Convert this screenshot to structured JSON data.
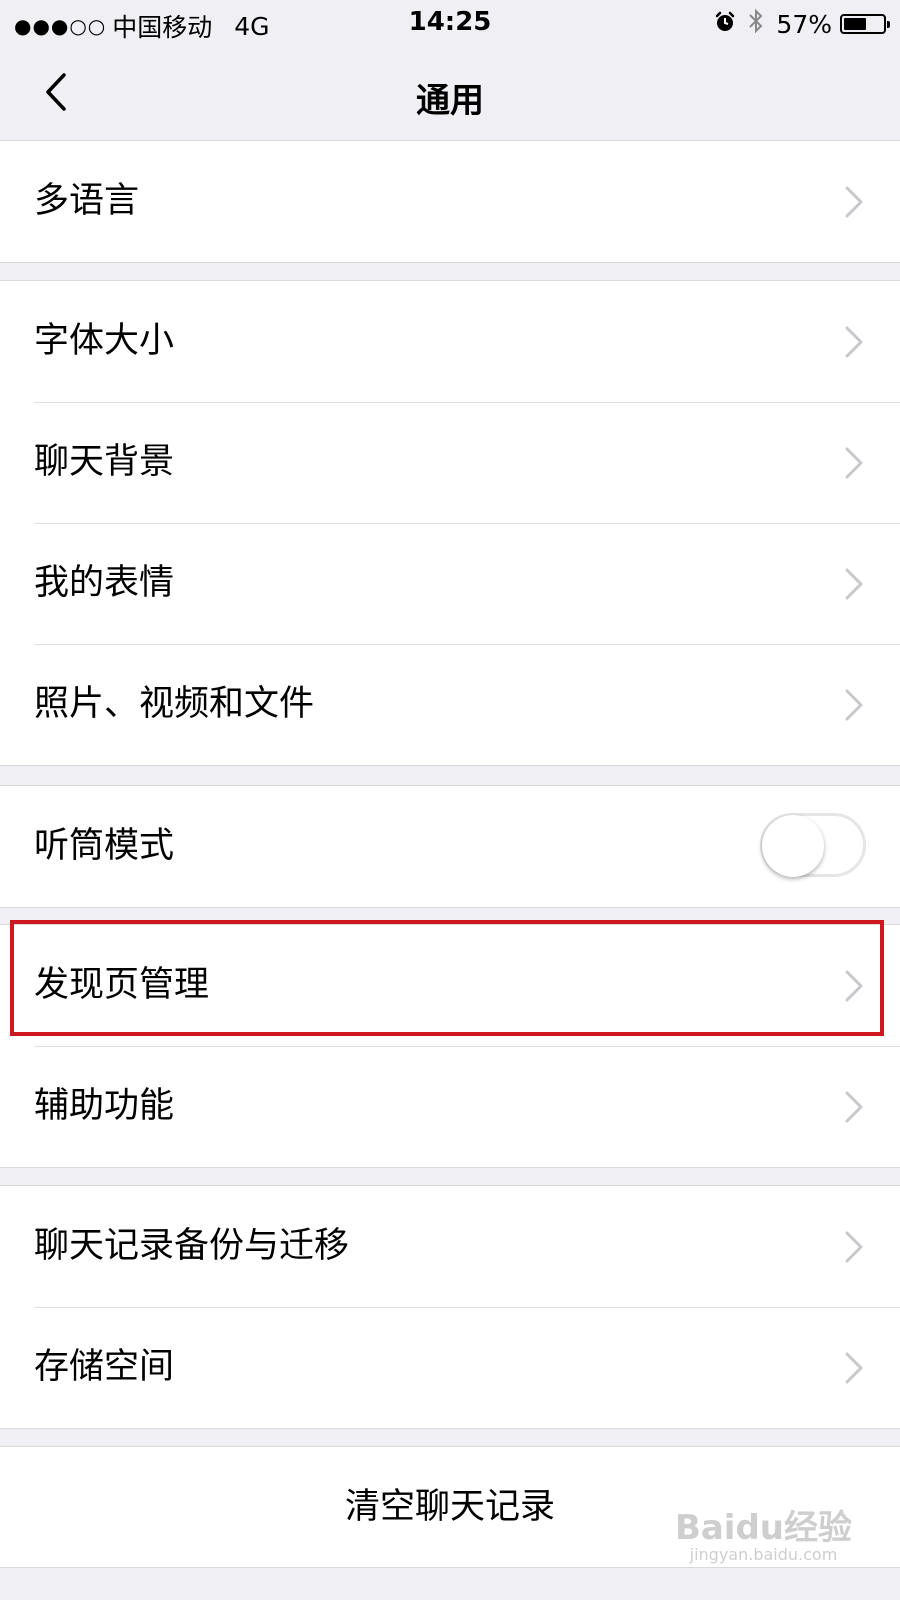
{
  "status_bar": {
    "signal": "●●●○○",
    "carrier": "中国移动",
    "network": "4G",
    "time": "14:25",
    "battery": "57%",
    "battery_level": 0.57,
    "icons": [
      "alarm-icon",
      "bluetooth-icon",
      "battery-icon"
    ]
  },
  "nav": {
    "title": "通用",
    "back_icon": "chevron-left-icon"
  },
  "sections": [
    {
      "items": [
        {
          "label": "多语言",
          "accessory": "chevron"
        }
      ]
    },
    {
      "items": [
        {
          "label": "字体大小",
          "accessory": "chevron"
        },
        {
          "label": "聊天背景",
          "accessory": "chevron"
        },
        {
          "label": "我的表情",
          "accessory": "chevron"
        },
        {
          "label": "照片、视频和文件",
          "accessory": "chevron"
        }
      ]
    },
    {
      "items": [
        {
          "label": "听筒模式",
          "accessory": "toggle",
          "toggle_on": false
        }
      ]
    },
    {
      "items": [
        {
          "label": "发现页管理",
          "accessory": "chevron",
          "highlighted": true
        },
        {
          "label": "辅助功能",
          "accessory": "chevron"
        }
      ]
    },
    {
      "items": [
        {
          "label": "聊天记录备份与迁移",
          "accessory": "chevron"
        },
        {
          "label": "存储空间",
          "accessory": "chevron"
        }
      ]
    }
  ],
  "clear_button": {
    "label": "清空聊天记录"
  },
  "watermark": {
    "logo": "Baidu经验",
    "url": "jingyan.baidu.com"
  },
  "colors": {
    "background": "#efeff4",
    "highlight": "#d0161e",
    "chevron": "#c7c7cc"
  }
}
